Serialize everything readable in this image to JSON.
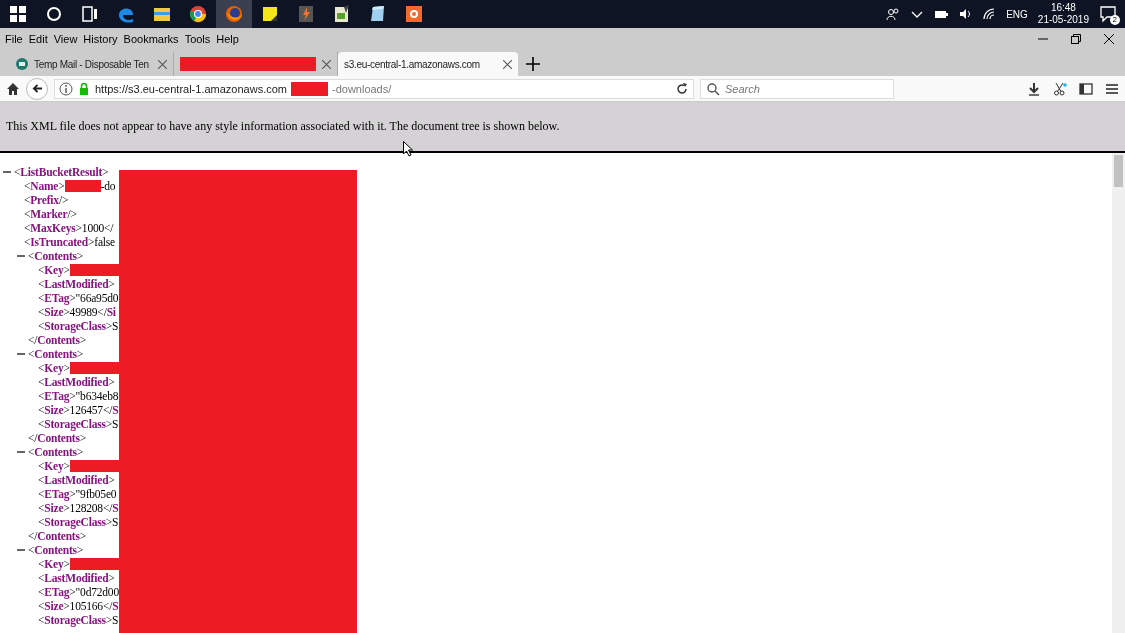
{
  "taskbar": {
    "apps": [
      {
        "kind": "start",
        "selected": false
      },
      {
        "kind": "search",
        "selected": false
      },
      {
        "kind": "taskview",
        "selected": false
      },
      {
        "kind": "edge",
        "selected": false
      },
      {
        "kind": "folder",
        "selected": false
      },
      {
        "kind": "chrome",
        "selected": false
      },
      {
        "kind": "firefox",
        "selected": true
      },
      {
        "kind": "note",
        "selected": false
      },
      {
        "kind": "bolt",
        "selected": false
      },
      {
        "kind": "sheet",
        "selected": false
      },
      {
        "kind": "notepad",
        "selected": false
      },
      {
        "kind": "record",
        "selected": false
      }
    ],
    "tray": {
      "language": "ENG",
      "time": "16:48",
      "date": "21-05-2019",
      "notifications": "2"
    }
  },
  "menu": [
    "File",
    "Edit",
    "View",
    "History",
    "Bookmarks",
    "Tools",
    "Help"
  ],
  "tabs": [
    {
      "title": "Temp Mail - Disposable Ten",
      "selected": false,
      "redacted": false
    },
    {
      "selected": false,
      "redacted": true
    },
    {
      "title": "s3.eu-central-1.amazonaws.com",
      "selected": true,
      "redacted": false
    }
  ],
  "address": {
    "url_start": "https://s3.eu-central-1.amazonaws.com",
    "url_end": "-downloads/"
  },
  "search": {
    "placeholder": "Search"
  },
  "notice": "This XML file does not appear to have any style information associated with it. The document tree is shown below.",
  "xml": {
    "kind": "element",
    "open": "<**ListBucketResult**>",
    "expanded": true,
    "children": [
      {
        "kind": "leaf",
        "open": "<**Name**>",
        "redacted": true,
        "value": "-do"
      },
      {
        "kind": "leaf",
        "open": "<**Prefix**/>",
        "redacted": false
      },
      {
        "kind": "leaf",
        "open": "<**Marker**/>",
        "redacted": false
      },
      {
        "kind": "leaf",
        "open": "<**MaxKeys**>",
        "redacted": false,
        "value": "1000</"
      },
      {
        "kind": "leaf",
        "open": "<**IsTruncated**>",
        "redacted": false,
        "value": "false"
      },
      {
        "kind": "element",
        "open": "<**Contents**>",
        "expanded": true,
        "close": "</**Contents**>",
        "children": [
          {
            "kind": "leaf",
            "open": "<**Key**>",
            "redacted": true
          },
          {
            "kind": "leaf",
            "open": "<**LastModified**>",
            "redacted": false
          },
          {
            "kind": "leaf",
            "open": "<**ETag**>",
            "redacted": false,
            "value": "\"66a95d0"
          },
          {
            "kind": "leaf",
            "open": "<**Size**>",
            "redacted": false,
            "value": "49989</**Si**"
          },
          {
            "kind": "leaf",
            "open": "<**StorageClass**>",
            "redacted": false,
            "value": "S"
          }
        ]
      },
      {
        "kind": "element",
        "open": "<**Contents**>",
        "expanded": true,
        "close": "</**Contents**>",
        "children": [
          {
            "kind": "leaf",
            "open": "<**Key**>",
            "redacted": true
          },
          {
            "kind": "leaf",
            "open": "<**LastModified**>",
            "redacted": false
          },
          {
            "kind": "leaf",
            "open": "<**ETag**>",
            "redacted": false,
            "value": "\"b634eb8"
          },
          {
            "kind": "leaf",
            "open": "<**Size**>",
            "redacted": false,
            "value": "126457</**S**"
          },
          {
            "kind": "leaf",
            "open": "<**StorageClass**>",
            "redacted": false,
            "value": "S"
          }
        ]
      },
      {
        "kind": "element",
        "open": "<**Contents**>",
        "expanded": true,
        "close": "</**Contents**>",
        "children": [
          {
            "kind": "leaf",
            "open": "<**Key**>",
            "redacted": true
          },
          {
            "kind": "leaf",
            "open": "<**LastModified**>",
            "redacted": false
          },
          {
            "kind": "leaf",
            "open": "<**ETag**>",
            "redacted": false,
            "value": "\"9fb05e0"
          },
          {
            "kind": "leaf",
            "open": "<**Size**>",
            "redacted": false,
            "value": "128208</**S**"
          },
          {
            "kind": "leaf",
            "open": "<**StorageClass**>",
            "redacted": false,
            "value": "S"
          }
        ]
      },
      {
        "kind": "element",
        "open": "<**Contents**>",
        "expanded": true,
        "children": [
          {
            "kind": "leaf",
            "open": "<**Key**>",
            "redacted": true
          },
          {
            "kind": "leaf",
            "open": "<**LastModified**>",
            "redacted": false
          },
          {
            "kind": "leaf",
            "open": "<**ETag**>",
            "redacted": false,
            "value": "\"0d72d00"
          },
          {
            "kind": "leaf",
            "open": "<**Size**>",
            "redacted": false,
            "value": "105166</**S**"
          },
          {
            "kind": "leaf",
            "open": "<**StorageClass**>",
            "redacted": false,
            "value": "S"
          }
        ]
      }
    ]
  }
}
